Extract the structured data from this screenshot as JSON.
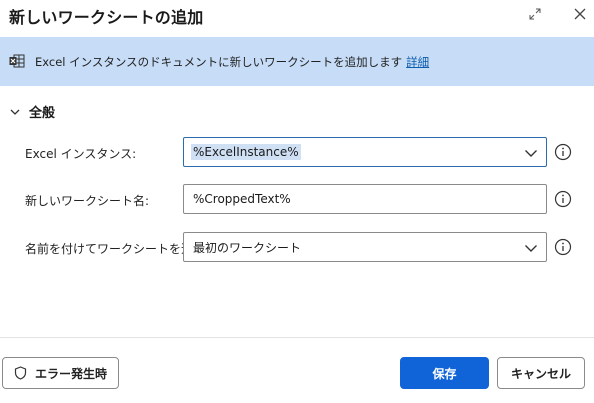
{
  "dialog": {
    "title": "新しいワークシートの追加"
  },
  "banner": {
    "icon": "excel-icon",
    "message": "Excel インスタンスのドキュメントに新しいワークシートを追加します",
    "link": "詳細"
  },
  "section": {
    "label": "全般",
    "expanded": true
  },
  "fields": {
    "instance": {
      "label": "Excel インスタンス:",
      "value": "%ExcelInstance%"
    },
    "name": {
      "label": "新しいワークシート名:",
      "value": "%CroppedText%"
    },
    "position": {
      "label": "名前を付けてワークシートを追加:",
      "value": "最初のワークシート"
    }
  },
  "buttons": {
    "on_error": "エラー発生時",
    "save": "保存",
    "cancel": "キャンセル"
  },
  "colors": {
    "accent": "#1064d8",
    "banner_bg": "#c7dcf7",
    "link": "#0b5cad"
  }
}
